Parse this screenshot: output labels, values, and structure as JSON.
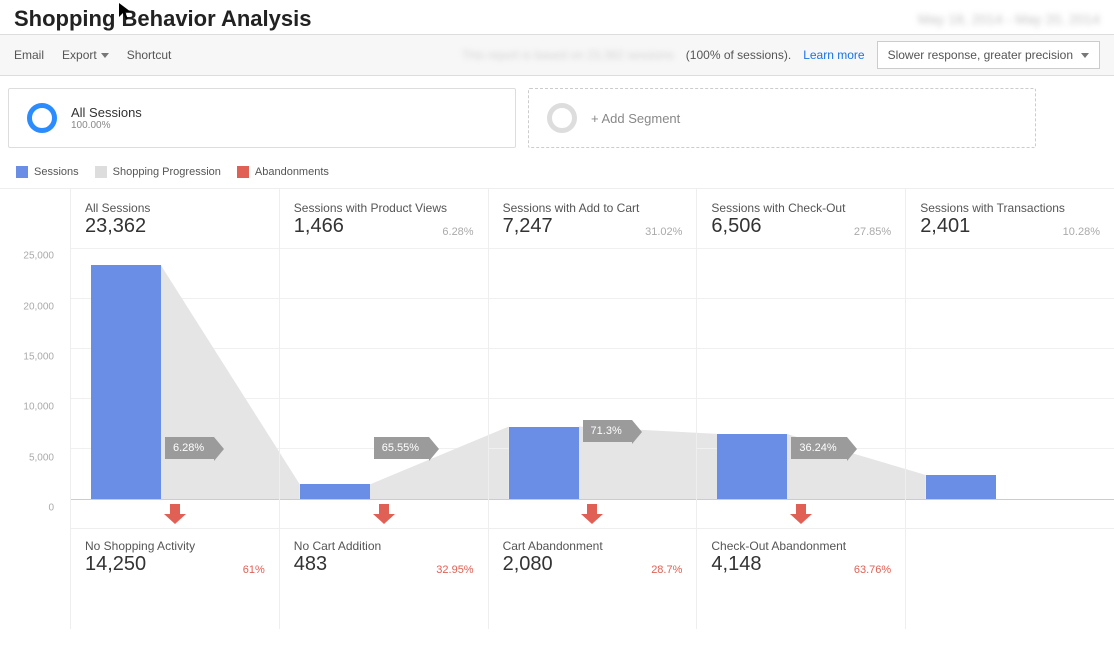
{
  "title": "Shopping Behavior Analysis",
  "toolbar": {
    "email": "Email",
    "export": "Export",
    "shortcut": "Shortcut",
    "session_note": "(100% of sessions).",
    "learn_more": "Learn more",
    "precision": "Slower response, greater precision"
  },
  "segments": {
    "active": {
      "name": "All Sessions",
      "pct": "100.00%"
    },
    "add": "+ Add Segment"
  },
  "legend": {
    "sessions": "Sessions",
    "progression": "Shopping Progression",
    "abandon": "Abandonments"
  },
  "chart_data": {
    "type": "bar",
    "title": "Shopping Behavior Analysis",
    "ylabel": "Sessions",
    "ylim": [
      0,
      25000
    ],
    "yticks": [
      0,
      5000,
      10000,
      15000,
      20000,
      25000
    ],
    "categories": [
      "All Sessions",
      "Sessions with Product Views",
      "Sessions with Add to Cart",
      "Sessions with Check-Out",
      "Sessions with Transactions"
    ],
    "values": [
      23362,
      1466,
      7247,
      6506,
      2401
    ],
    "stage_pct": [
      null,
      "6.28%",
      "31.02%",
      "27.85%",
      "10.28%"
    ],
    "flow_pct": [
      "6.28%",
      "65.55%",
      "71.3%",
      "36.24%"
    ],
    "abandonments": {
      "labels": [
        "No Shopping Activity",
        "No Cart Addition",
        "Cart Abandonment",
        "Check-Out Abandonment"
      ],
      "values": [
        14250,
        483,
        2080,
        4148
      ],
      "pct": [
        "61%",
        "32.95%",
        "28.7%",
        "63.76%"
      ]
    }
  },
  "yticks_label": [
    "0",
    "5,000",
    "10,000",
    "15,000",
    "20,000",
    "25,000"
  ],
  "stages": [
    {
      "label": "All Sessions",
      "value": "23,362",
      "pct": ""
    },
    {
      "label": "Sessions with Product Views",
      "value": "1,466",
      "pct": "6.28%"
    },
    {
      "label": "Sessions with Add to Cart",
      "value": "7,247",
      "pct": "31.02%"
    },
    {
      "label": "Sessions with Check-Out",
      "value": "6,506",
      "pct": "27.85%"
    },
    {
      "label": "Sessions with Transactions",
      "value": "2,401",
      "pct": "10.28%"
    }
  ],
  "flows": [
    "6.28%",
    "65.55%",
    "71.3%",
    "36.24%"
  ],
  "abandon": [
    {
      "label": "No Shopping Activity",
      "value": "14,250",
      "pct": "61%"
    },
    {
      "label": "No Cart Addition",
      "value": "483",
      "pct": "32.95%"
    },
    {
      "label": "Cart Abandonment",
      "value": "2,080",
      "pct": "28.7%"
    },
    {
      "label": "Check-Out Abandonment",
      "value": "4,148",
      "pct": "63.76%"
    }
  ]
}
